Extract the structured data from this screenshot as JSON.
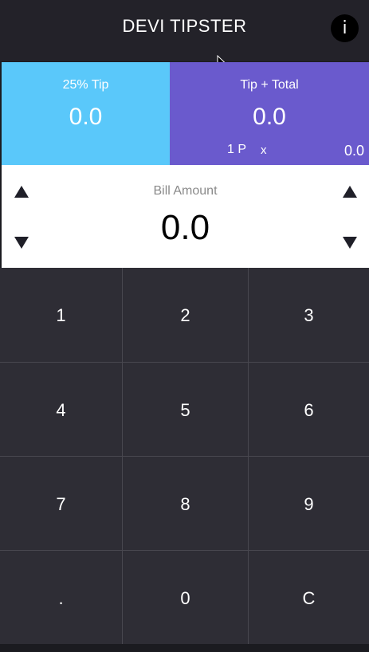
{
  "header": {
    "title": "DEVI TIPSTER",
    "info_label": "i"
  },
  "tip_panel": {
    "label": "25% Tip",
    "value": "0.0",
    "color": "#5ac8fa"
  },
  "total_panel": {
    "label": "Tip + Total",
    "value": "0.0",
    "persons": "1 P",
    "times": "x",
    "per_person_value": "0.0",
    "color": "#6a5acd"
  },
  "bill": {
    "label": "Bill Amount",
    "value": "0.0"
  },
  "keypad": {
    "keys": [
      "1",
      "2",
      "3",
      "4",
      "5",
      "6",
      "7",
      "8",
      "9",
      ".",
      "0",
      "C"
    ]
  }
}
